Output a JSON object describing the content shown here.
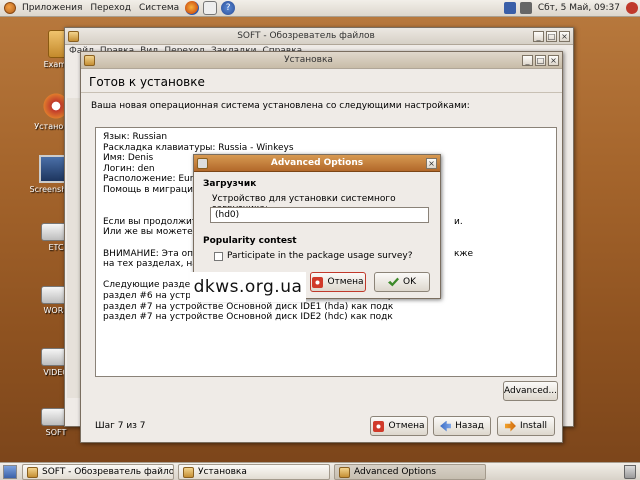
{
  "top_panel": {
    "menus": [
      "Приложения",
      "Переход",
      "Система"
    ],
    "clock": "Сбт, 5 Май, 09:37"
  },
  "desktop": {
    "icons": [
      {
        "label": "Examples"
      },
      {
        "label": "Установка"
      },
      {
        "label": "Screenshots"
      },
      {
        "label": "ETC"
      },
      {
        "label": "WORK"
      },
      {
        "label": "VIDEO"
      },
      {
        "label": "SOFT"
      }
    ]
  },
  "file_browser": {
    "title": "SOFT - Обозреватель файлов",
    "menu": [
      "Файл",
      "Правка",
      "Вид",
      "Переход",
      "Закладки",
      "Справка"
    ]
  },
  "installer": {
    "title": "Установка",
    "heading": "Готов к установке",
    "intro": "Ваша новая операционная система установлена со следующими настройками:",
    "summary": [
      "Язык: Russian",
      "Раскладка клавиатуры: Russia - Winkeys",
      "Имя: Denis",
      "Логин: den",
      "Расположение: Europ",
      "Помощь в миграции:",
      "",
      "",
      "Если вы продолжите,",
      "Или же вы можете сд",
      "",
      "ВНИМАНИЕ: Эта опер",
      "на тех разделах, на к",
      "",
      "Следующие разделы",
      " раздел #6 на устройстве Основной диск IDE1 (hda) как swap",
      " раздел #7 на устройстве Основной диск IDE1 (hda) как подк",
      " раздел #7 на устройстве Основной диск IDE2 (hdc) как подк"
    ],
    "summary_right_fragments": {
      "line9": "и.",
      "line12": "кже"
    },
    "advanced_label": "Advanced...",
    "step": "Шаг 7 из 7",
    "cancel_label": "Отмена",
    "back_label": "Назад",
    "install_label": "Install"
  },
  "advanced_dialog": {
    "title": "Advanced Options",
    "bootloader_section": "Загрузчик",
    "bootloader_prompt": "Устройство для установки системного загрузчика:",
    "bootloader_value": "(hd0)",
    "popcon_section": "Popularity contest",
    "popcon_checkbox": "Participate in the package usage survey?",
    "popcon_checked": false,
    "cancel_label": "Отмена",
    "ok_label": "OK"
  },
  "watermark": "dkws.org.ua",
  "taskbar": {
    "tasks": [
      "SOFT - Обозреватель файлов",
      "Установка",
      "Advanced Options"
    ]
  },
  "colors": {
    "desktop": "#a5652c",
    "dialog_title": "#c47a36",
    "window_bg": "#efebe7"
  }
}
